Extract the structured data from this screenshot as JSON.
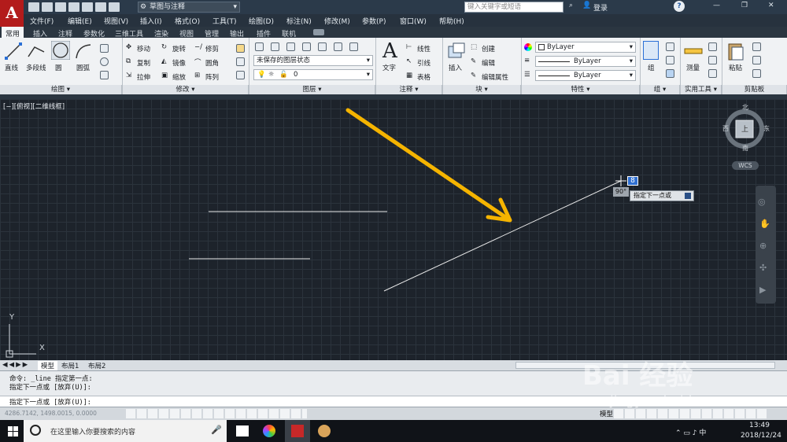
{
  "app": {
    "logo": "A",
    "workspace": "草图与注释",
    "search_placeholder": "键入关键字或短语",
    "login": "登录"
  },
  "menu": [
    "文件(F)",
    "编辑(E)",
    "视图(V)",
    "插入(I)",
    "格式(O)",
    "工具(T)",
    "绘图(D)",
    "标注(N)",
    "修改(M)",
    "参数(P)",
    "窗口(W)",
    "帮助(H)"
  ],
  "tabs": [
    "常用",
    "插入",
    "注释",
    "参数化",
    "三维工具",
    "渲染",
    "视图",
    "管理",
    "输出",
    "插件",
    "联机"
  ],
  "ribbon": {
    "draw": {
      "line": "直线",
      "polyline": "多段线",
      "circle": "圆",
      "arc": "圆弧",
      "panel": "绘图 ▾"
    },
    "modify": {
      "move": "移动",
      "rotate": "旋转",
      "trim": "修剪",
      "copy": "复制",
      "mirror": "镜像",
      "fillet": "圆角",
      "stretch": "拉伸",
      "scale": "缩放",
      "array": "阵列",
      "panel": "修改 ▾"
    },
    "layers": {
      "state": "未保存的图层状态",
      "current": "0",
      "panel": "图层 ▾"
    },
    "annotation": {
      "text": "文字",
      "linear": "线性",
      "leader": "引线",
      "table": "表格",
      "panel": "注释 ▾"
    },
    "block": {
      "insert": "插入",
      "create": "创建",
      "edit": "编辑",
      "edit_attr": "编辑属性",
      "panel": "块 ▾"
    },
    "properties": {
      "color": "ByLayer",
      "linetype": "ByLayer",
      "lineweight": "ByLayer",
      "panel": "特性 ▾"
    },
    "groups": {
      "group": "组",
      "panel": "组 ▾"
    },
    "utilities": {
      "measure": "测量",
      "panel": "实用工具 ▾"
    },
    "clipboard": {
      "paste": "粘贴",
      "panel": "剪贴板"
    }
  },
  "viewport": {
    "label": "[−][俯视][二维线框]",
    "compass": {
      "north": "北",
      "south": "南",
      "east": "东",
      "west": "西",
      "top": "上"
    },
    "wcs": "WCS",
    "ucs_y": "Y",
    "ucs_x": "X",
    "dyn_input_value": "8",
    "angle_tooltip": "90°",
    "prompt_tooltip": "指定下一点或"
  },
  "layout_tabs": [
    "模型",
    "布局1",
    "布局2"
  ],
  "command": {
    "history": [
      "命令: _line 指定第一点:",
      "指定下一点或 [放弃(U)]:"
    ],
    "current": "指定下一点或 [放弃(U)]:",
    "coords": "4286.7142, 1498.0015, 0.0000"
  },
  "status": {
    "model": "模型"
  },
  "taskbar": {
    "search_placeholder": "在这里输入你要搜索的内容",
    "time": "13:49",
    "date": "2018/12/24"
  },
  "watermark": {
    "text": "Bai 经验",
    "url": "jingyan.baidu.com"
  },
  "colors": {
    "accent_arrow": "#f5b400",
    "drawing_line": "#e8e8e8",
    "ribbon_bg": "#f0f2f4",
    "canvas_bg": "#1d232b"
  }
}
